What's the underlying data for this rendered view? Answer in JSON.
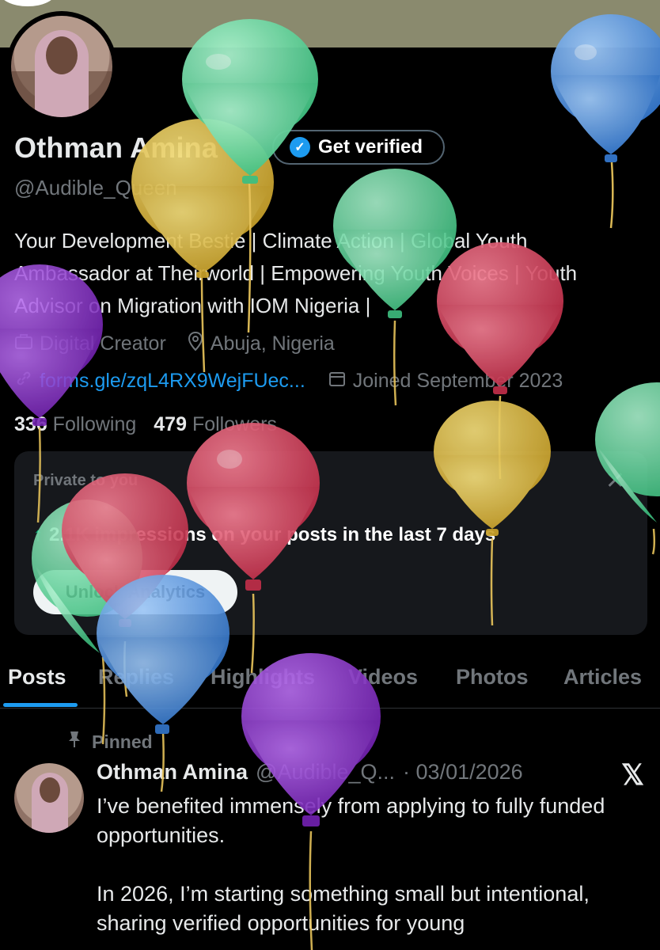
{
  "profile": {
    "name": "Othman Amina",
    "verify_label": "Get verified",
    "handle": "@Audible_Queen",
    "bio": "Your Development Bestie | Climate Action | Global Youth Ambassador at Theirworld | Empowering Youth Voices | Youth Advisor on Migration with IOM Nigeria |",
    "category": "Digital Creator",
    "location": "Abuja, Nigeria",
    "link": "forms.gle/zqL4RX9WejFUec...",
    "joined": "Joined September 2023",
    "following_count": "336",
    "following_label": "Following",
    "followers_count": "479",
    "followers_label": "Followers"
  },
  "analytics_card": {
    "private_label": "Private to you",
    "impressions_text": "2.1K impressions on your posts in the last 7 days",
    "unlock_label": "Unlock Analytics",
    "close_icon": "close-icon"
  },
  "tabs": [
    "Posts",
    "Replies",
    "Highlights",
    "Videos",
    "Photos",
    "Articles"
  ],
  "pinned_post": {
    "pinned_label": "Pinned",
    "author": "Othman Amina",
    "handle": "@Audible_Q...",
    "date": "· 03/01/2026",
    "text": "I’ve benefited immensely from applying to fully funded opportunities.\n\nIn 2026, I’m starting something small but intentional, sharing verified opportunities for young"
  },
  "balloon_colors": {
    "green": "#5fd39a",
    "blue": "#4a90e2",
    "yellow": "#d9b43a",
    "purple": "#8b34c9",
    "red": "#d6405a"
  }
}
